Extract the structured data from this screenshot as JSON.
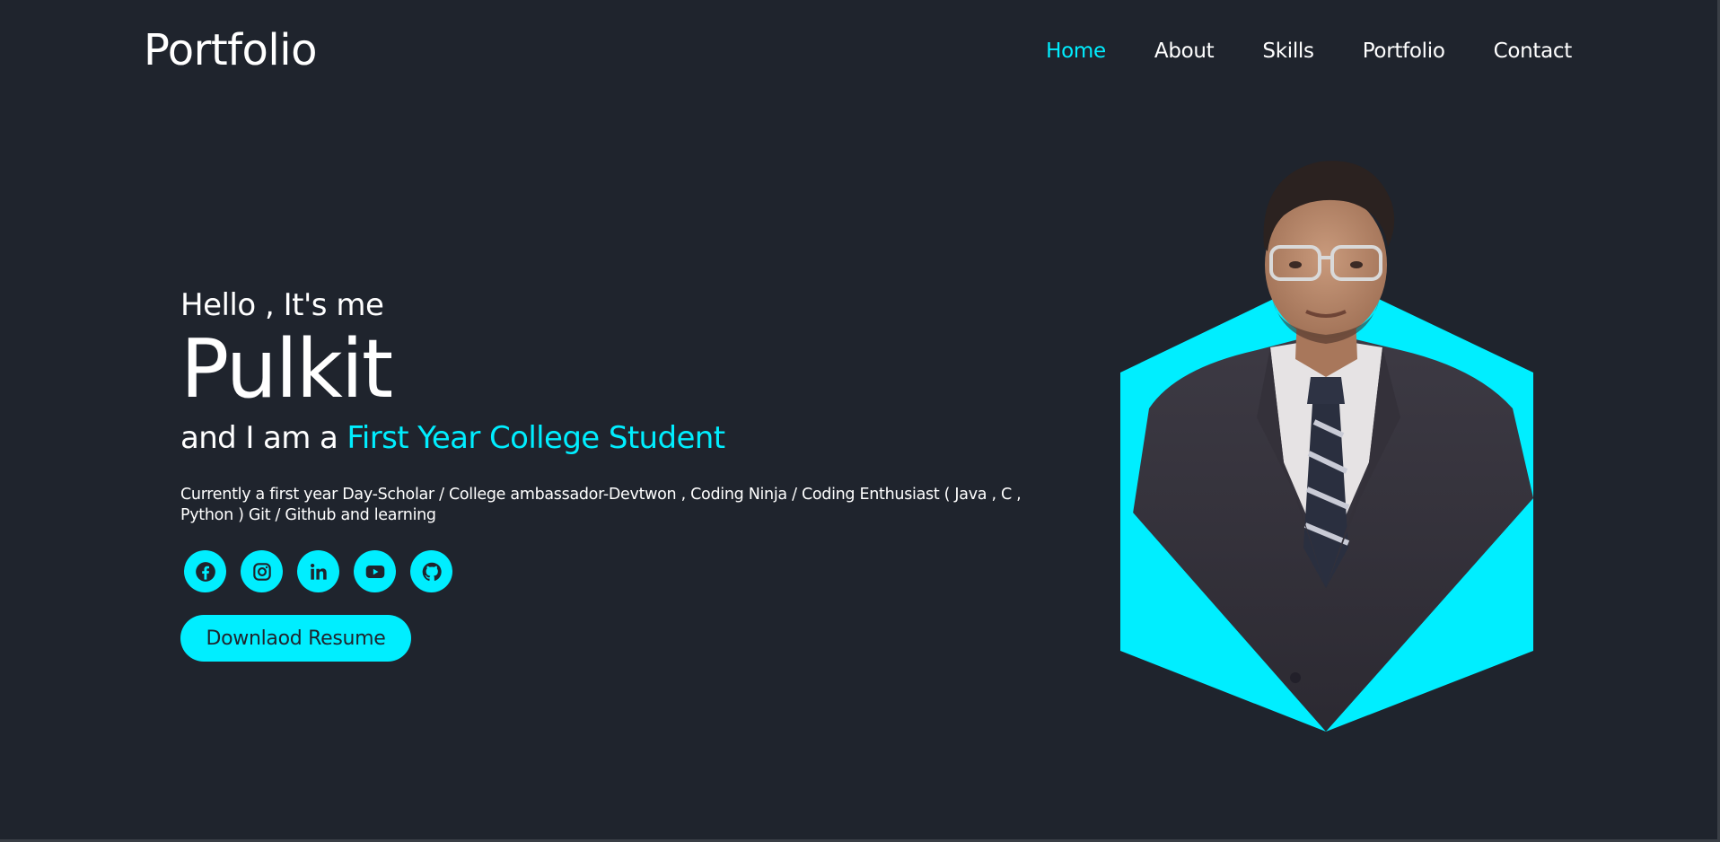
{
  "header": {
    "logo": "Portfolio",
    "nav": [
      {
        "label": "Home",
        "active": true
      },
      {
        "label": "About",
        "active": false
      },
      {
        "label": "Skills",
        "active": false
      },
      {
        "label": "Portfolio",
        "active": false
      },
      {
        "label": "Contact",
        "active": false
      }
    ]
  },
  "hero": {
    "greeting": "Hello , It's me",
    "name": "Pulkit",
    "role_prefix": "and I am a ",
    "role_highlight": "First Year College Student",
    "description": "Currently a first year Day-Scholar / College ambassador-Devtwon , Coding Ninja / Coding Enthusiast ( Java , C , Python ) Git / Github and learning",
    "socials": [
      {
        "icon": "facebook-icon"
      },
      {
        "icon": "instagram-icon"
      },
      {
        "icon": "linkedin-icon"
      },
      {
        "icon": "youtube-icon"
      },
      {
        "icon": "github-icon"
      }
    ],
    "button_label": "Downlaod Resume"
  },
  "colors": {
    "background": "#1f242d",
    "accent": "#00eeff",
    "text": "#ffffff"
  }
}
